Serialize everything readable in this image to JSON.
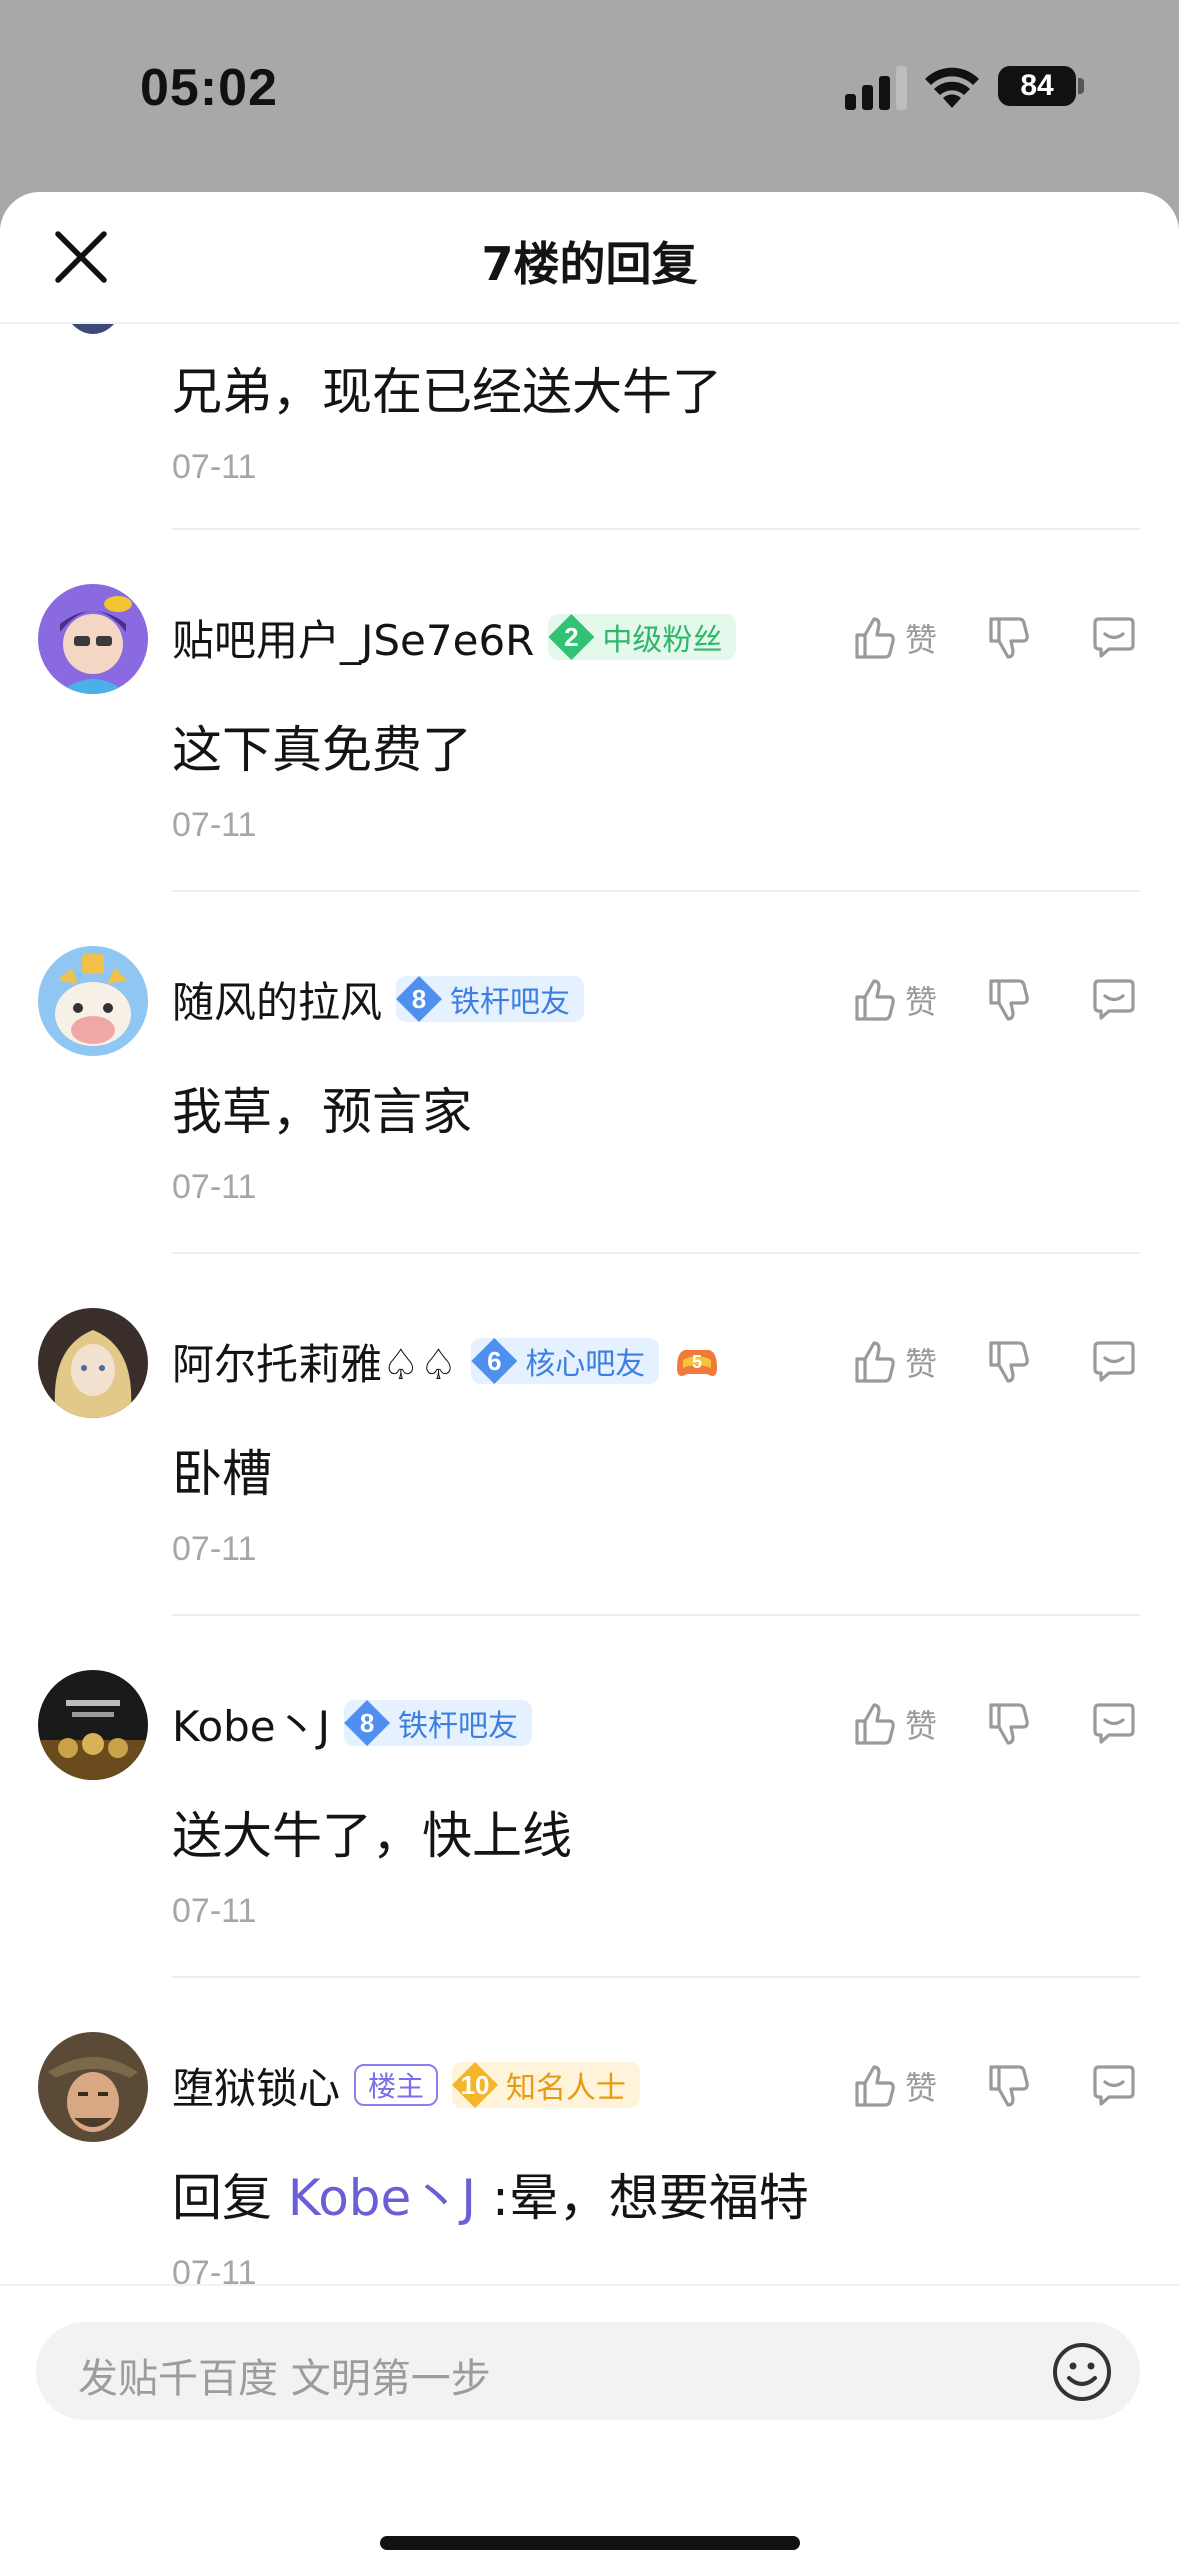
{
  "status_bar": {
    "time": "05:02",
    "battery": "84"
  },
  "header": {
    "title": "7楼的回复"
  },
  "first_comment": {
    "text": "兄弟，现在已经送大牛了",
    "date": "07-11"
  },
  "actions": {
    "like_label": "赞"
  },
  "replies": [
    {
      "username": "贴吧用户_JSe7e6R",
      "badge": {
        "level": "2",
        "label": "中级粉丝",
        "color": "green"
      },
      "text": "这下真免费了",
      "date": "07-11"
    },
    {
      "username": "随风的拉风",
      "badge": {
        "level": "8",
        "label": "铁杆吧友",
        "color": "blue"
      },
      "text": "我草，预言家",
      "date": "07-11"
    },
    {
      "username": "阿尔托莉雅♤♤",
      "badge": {
        "level": "6",
        "label": "核心吧友",
        "color": "blue"
      },
      "extra_icon": {
        "name": "game-badge-icon",
        "value": "5"
      },
      "text": "卧槽",
      "date": "07-11"
    },
    {
      "username": "Kobe丶J",
      "badge": {
        "level": "8",
        "label": "铁杆吧友",
        "color": "blue"
      },
      "text": "送大牛了，快上线",
      "date": "07-11"
    },
    {
      "username": "堕狱锁心",
      "owner_tag": "楼主",
      "badge": {
        "level": "10",
        "label": "知名人士",
        "color": "gold"
      },
      "text_prefix": "回复 ",
      "mention": "Kobe丶J",
      "text": " :晕，想要福特",
      "date": "07-11"
    }
  ],
  "input": {
    "placeholder": "发贴千百度 文明第一步"
  }
}
